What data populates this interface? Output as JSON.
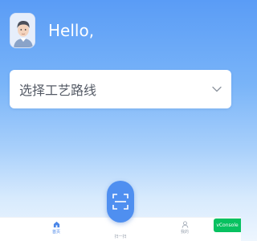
{
  "header": {
    "greeting": "Hello,"
  },
  "route_select": {
    "placeholder": "选择工艺路线"
  },
  "tabbar": {
    "items": [
      {
        "label": "首页",
        "icon": "home-icon",
        "active": true
      },
      {
        "label": "扫一扫",
        "icon": "scan-icon",
        "active": false
      },
      {
        "label": "我的",
        "icon": "user-icon",
        "active": false
      }
    ]
  },
  "vconsole": {
    "label": "vConsole"
  },
  "colors": {
    "accent": "#4f8ff0",
    "active_tab": "#4a86e8",
    "inactive_tab": "#9aa3b0",
    "vconsole": "#07c160"
  }
}
